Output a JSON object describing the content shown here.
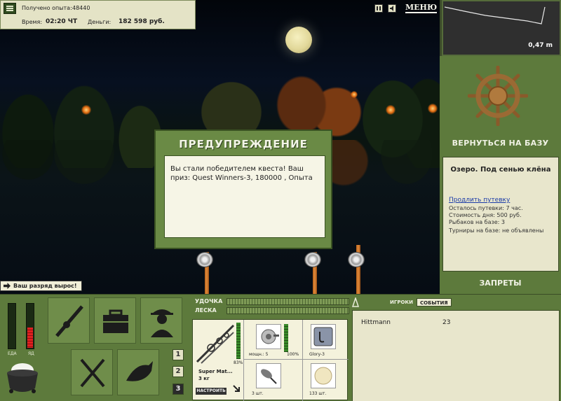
{
  "top_info": {
    "exp_label": "Получено опыта:",
    "exp_value": "48440",
    "time_label": "Время:",
    "time_value": "02:20 ЧТ",
    "money_label": "Деньги:",
    "money_value": "182 598 руб."
  },
  "header": {
    "menu_label": "МЕНЮ"
  },
  "minimap": {
    "depth": "0,47 m"
  },
  "right_panel": {
    "return_button": "ВЕРНУТЬСЯ НА БАЗУ",
    "lake_name": "Озеро. Под сенью клёна",
    "extend_link": "Продлить путевку",
    "info": [
      "Осталось путевки: 7 час.",
      "Стоимость дня: 500 руб.",
      "Рыбаков на базе: 3",
      "Турниры на базе: не объявлены"
    ],
    "bans_button": "ЗАПРЕТЫ"
  },
  "dialog": {
    "title": "ПРЕДУПРЕЖДЕНИЕ",
    "message": "Вы стали победителем квеста! Ваш приз: Quest Winners-3, 180000 , Опыта"
  },
  "rank_notice": "Ваш разряд вырос!",
  "meters": {
    "food_label": "ЕДА",
    "food_level": 0,
    "poison_label": "ЯД",
    "poison_level": 0.45
  },
  "slots": {
    "buttons": [
      "1",
      "2",
      "3"
    ],
    "active": "3"
  },
  "tackle": {
    "rod_label": "УДОЧКА",
    "line_label": "ЛЕСКА",
    "rod_percent": "83%",
    "rod_name": "Super Mat...",
    "rod_weight": "3 кг",
    "setup_button": "НАСТРОИТЬ",
    "reel_power": "мощн.: 5",
    "reel_percent": "100%",
    "hook_name": "Glory-3",
    "lure_count": "3 шт.",
    "bait_count": "133 шт."
  },
  "players": {
    "tab_players": "ИГРОКИ",
    "tab_events": "СОБЫТИЯ",
    "rows": [
      {
        "name": "Hittmann",
        "value": "23"
      }
    ]
  },
  "colors": {
    "panel_green": "#5d7a3c",
    "cream": "#e8e6cc",
    "link_blue": "#1a3aa8"
  }
}
